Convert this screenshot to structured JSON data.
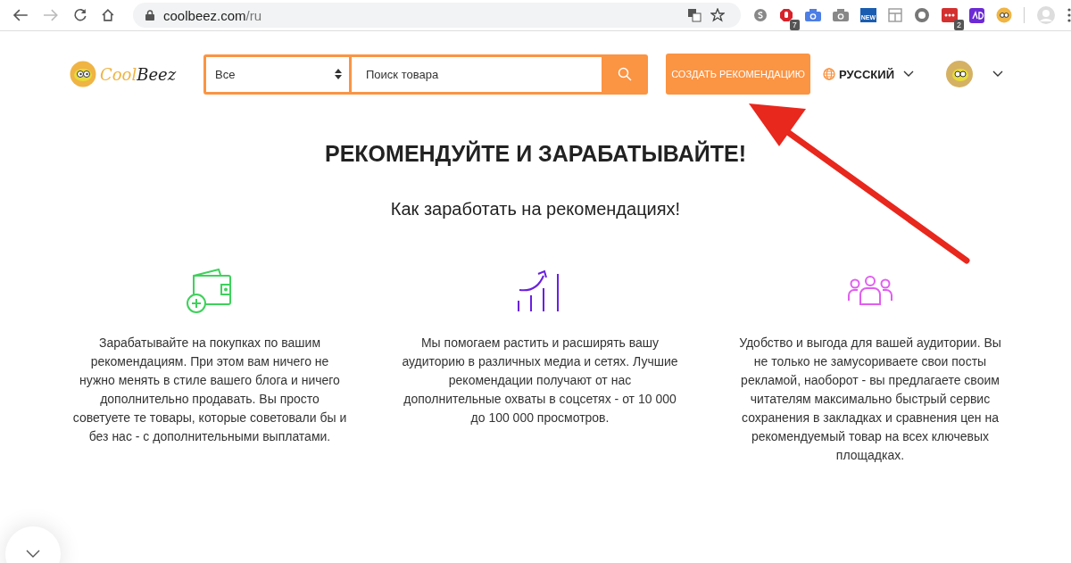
{
  "browser": {
    "url_host": "coolbeez.com",
    "url_path": "/ru",
    "extensions": [
      {
        "kind": "skype"
      },
      {
        "kind": "stop",
        "badge": "7"
      },
      {
        "kind": "camera-blue"
      },
      {
        "kind": "camera-grey"
      },
      {
        "kind": "new",
        "label": "NEW"
      },
      {
        "kind": "layout"
      },
      {
        "kind": "ring"
      },
      {
        "kind": "dots",
        "badge": "2"
      },
      {
        "kind": "purple"
      },
      {
        "kind": "bee"
      }
    ]
  },
  "header": {
    "logo_a": "Cool",
    "logo_b": "Beez",
    "category": "Все",
    "search_placeholder": "Поиск товара",
    "create_button": "СОЗДАТЬ РЕКОМЕНДАЦИЮ",
    "language": "РУССКИЙ"
  },
  "hero": {
    "title": "РЕКОМЕНДУЙТЕ И ЗАРАБАТЫВАЙТЕ!",
    "subtitle": "Как заработать на рекомендациях!"
  },
  "features": [
    {
      "kind": "wallet",
      "color": "#3ed15b",
      "text": "Зарабатывайте на покупках по вашим рекомендациям. При этом вам ничего не нужно менять в стиле вашего блога и ничего дополнительно продавать. Вы просто советуете те товары, которые советовали бы и без нас - с дополнительными выплатами."
    },
    {
      "kind": "growth",
      "color": "#6a1fe0",
      "text": "Мы помогаем растить и расширять вашу аудиторию в различных медиа и сетях. Лучшие рекомендации получают от нас дополнительные охваты в соцсетях - от 10 000 до 100 000 просмотров."
    },
    {
      "kind": "people",
      "color": "#e15ef0",
      "text": "Удобство и выгода для вашей аудитории. Вы не только не замусориваете свои посты рекламой, наоборот - вы предлагаете своим читателям максимально быстрый сервис сохранения в закладках и сравнения цен на рекомендуемый товар на всех ключевых площадках."
    }
  ]
}
